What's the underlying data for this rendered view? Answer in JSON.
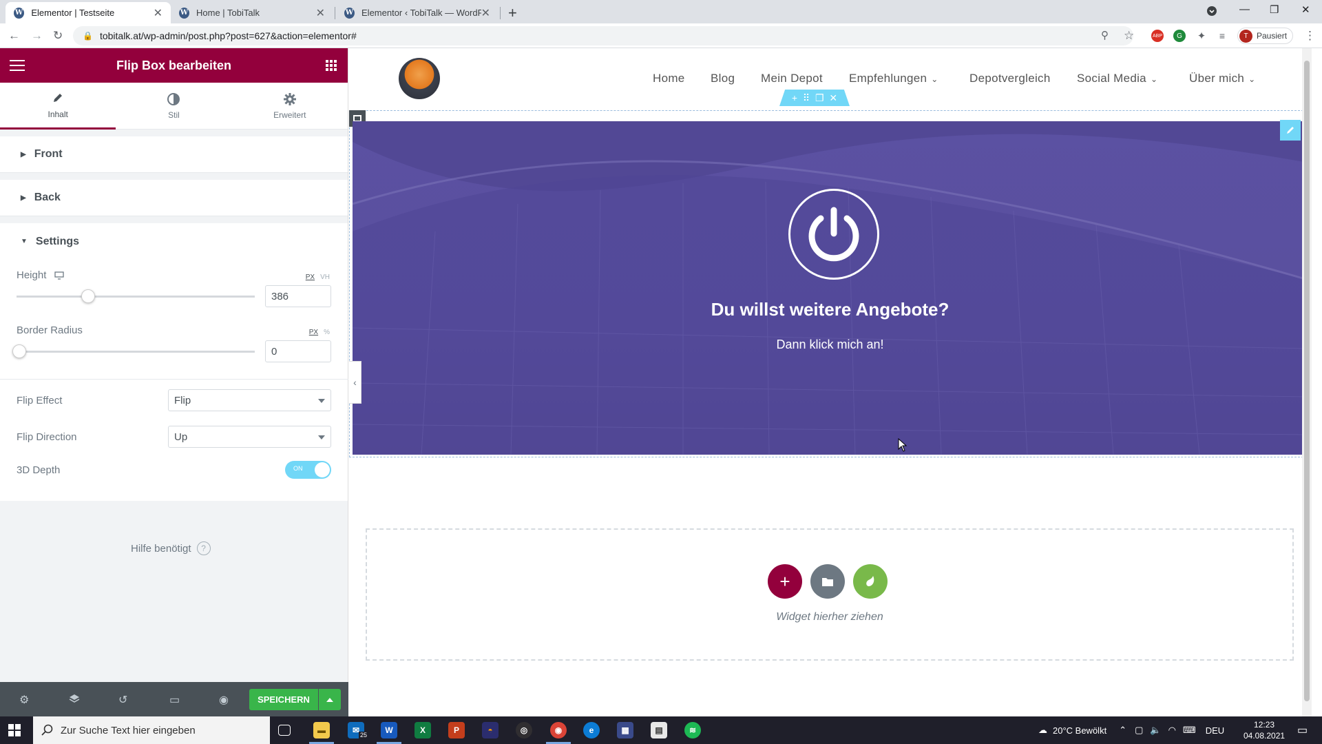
{
  "browser": {
    "tabs": [
      {
        "title": "Elementor | Testseite",
        "active": true
      },
      {
        "title": "Home | TobiTalk",
        "active": false
      },
      {
        "title": "Elementor ‹ TobiTalk — WordPre",
        "active": false
      }
    ],
    "url": "tobitalk.at/wp-admin/post.php?post=627&action=elementor#",
    "profile_label": "Pausiert",
    "profile_initial": "T",
    "ext_abp": "ABP"
  },
  "panel": {
    "title": "Flip Box bearbeiten",
    "tabs": [
      {
        "label": "Inhalt",
        "active": true,
        "icon": "pencil-icon"
      },
      {
        "label": "Stil",
        "active": false,
        "icon": "half-circle-icon"
      },
      {
        "label": "Erweitert",
        "active": false,
        "icon": "gear-icon"
      }
    ],
    "sections": {
      "front": "Front",
      "back": "Back",
      "settings": "Settings"
    },
    "height": {
      "label": "Height",
      "unit_active": "PX",
      "unit_other": "VH",
      "value": "386",
      "slider_fraction": 0.29
    },
    "border_radius": {
      "label": "Border Radius",
      "unit_active": "PX",
      "unit_other": "%",
      "value": "0",
      "slider_fraction": 0.0
    },
    "flip_effect": {
      "label": "Flip Effect",
      "value": "Flip"
    },
    "flip_direction": {
      "label": "Flip Direction",
      "value": "Up"
    },
    "depth_3d": {
      "label": "3D Depth",
      "toggle_text": "ON",
      "enabled": true
    },
    "help": "Hilfe benötigt",
    "help_mark": "?",
    "save_label": "SPEICHERN"
  },
  "site": {
    "nav": [
      {
        "label": "Home",
        "dropdown": false
      },
      {
        "label": "Blog",
        "dropdown": false
      },
      {
        "label": "Mein Depot",
        "dropdown": false
      },
      {
        "label": "Empfehlungen",
        "dropdown": true
      },
      {
        "label": "Depotvergleich",
        "dropdown": false
      },
      {
        "label": "Social Media",
        "dropdown": true
      },
      {
        "label": "Über mich",
        "dropdown": true
      }
    ],
    "flipbox": {
      "title": "Du willst weitere Angebote?",
      "description": "Dann klick mich an!",
      "overlay_color": "#5b51a2"
    },
    "dropzone_text": "Widget hierher ziehen"
  },
  "taskbar": {
    "search_placeholder": "Zur Suche Text hier eingeben",
    "mail_badge": "25",
    "weather": "20°C  Bewölkt",
    "language": "DEU",
    "time": "12:23",
    "date": "04.08.2021"
  },
  "colors": {
    "elementor_brand": "#93003c",
    "save_green": "#39b54a",
    "toolbar_cyan": "#71d7f7",
    "add_green": "#79b94a",
    "folder_grey": "#6d7882"
  }
}
